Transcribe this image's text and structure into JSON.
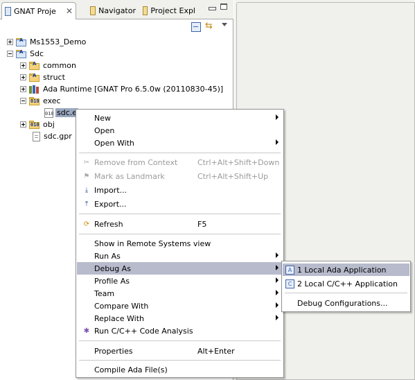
{
  "tabs": [
    {
      "label": "GNAT Proje",
      "active": true
    },
    {
      "label": "Navigator",
      "active": false
    },
    {
      "label": "Project Expl",
      "active": false
    }
  ],
  "tree": {
    "ms1553": "Ms1553_Demo",
    "sdc": "Sdc",
    "common": "common",
    "struct": "struct",
    "ada_runtime": "Ada Runtime [GNAT Pro 6.5.0w (20110830-45)]",
    "exec": "exec",
    "sdc_exe": "sdc.e",
    "obj": "obj",
    "sdc_gpr": "sdc.gpr",
    "binary_badge": "010",
    "folder_badge": "010"
  },
  "context_menu": {
    "new": "New",
    "open": "Open",
    "open_with": "Open With",
    "remove_ctx": "Remove from Context",
    "remove_ctx_sc": "Ctrl+Alt+Shift+Down",
    "mark_landmark": "Mark as Landmark",
    "mark_landmark_sc": "Ctrl+Alt+Shift+Up",
    "import": "Import...",
    "export": "Export...",
    "refresh": "Refresh",
    "refresh_sc": "F5",
    "show_remote": "Show in Remote Systems view",
    "run_as": "Run As",
    "debug_as": "Debug As",
    "profile_as": "Profile As",
    "team": "Team",
    "compare_with": "Compare With",
    "replace_with": "Replace With",
    "run_code_analysis": "Run C/C++ Code Analysis",
    "properties": "Properties",
    "properties_sc": "Alt+Enter",
    "compile_ada": "Compile Ada File(s)"
  },
  "submenu": {
    "local_ada": "1 Local Ada Application",
    "local_ada_badge": "A",
    "local_c": "2 Local C/C++ Application",
    "local_c_badge": "C",
    "debug_configs": "Debug Configurations..."
  },
  "colors": {
    "highlight": "#b7bbcc",
    "selection": "#9aa8c0",
    "disabled": "#9b9b9b"
  }
}
